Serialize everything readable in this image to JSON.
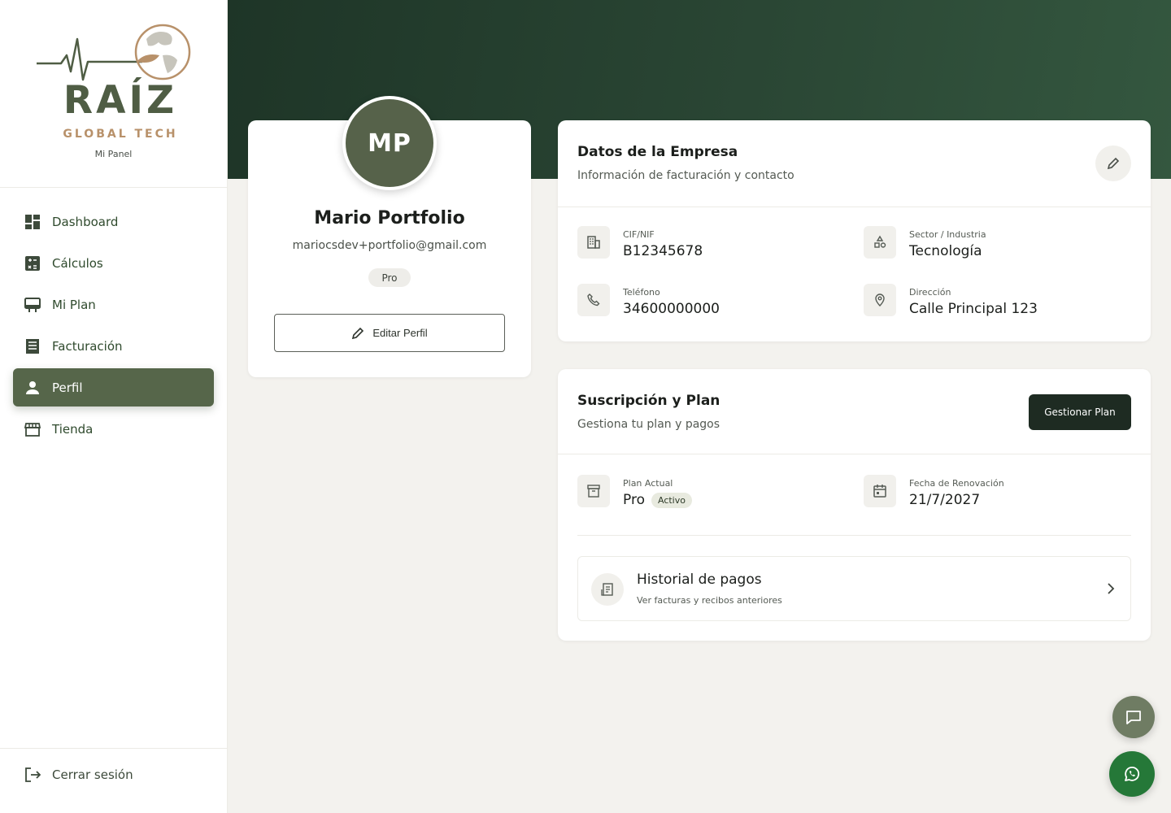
{
  "brand": {
    "name": "RAÍZ",
    "tagline": "GLOBAL TECH",
    "panel": "Mi Panel"
  },
  "sidebar": {
    "items": [
      {
        "label": "Dashboard",
        "icon": "dashboard-icon"
      },
      {
        "label": "Cálculos",
        "icon": "calculator-icon"
      },
      {
        "label": "Mi Plan",
        "icon": "plan-icon"
      },
      {
        "label": "Facturación",
        "icon": "billing-icon"
      },
      {
        "label": "Perfil",
        "icon": "person-icon",
        "active": true
      },
      {
        "label": "Tienda",
        "icon": "store-icon"
      }
    ],
    "logout": "Cerrar sesión"
  },
  "profile": {
    "initials": "MP",
    "name": "Mario Portfolio",
    "email": "mariocsdev+portfolio@gmail.com",
    "badge": "Pro",
    "edit_label": "Editar Perfil"
  },
  "company": {
    "title": "Datos de la Empresa",
    "subtitle": "Información de facturación y contacto",
    "fields": {
      "cif": {
        "label": "CIF/NIF",
        "value": "B12345678"
      },
      "sector": {
        "label": "Sector / Industria",
        "value": "Tecnología"
      },
      "phone": {
        "label": "Teléfono",
        "value": "34600000000"
      },
      "address": {
        "label": "Dirección",
        "value": "Calle Principal 123"
      }
    }
  },
  "subscription": {
    "title": "Suscripción y Plan",
    "subtitle": "Gestiona tu plan y pagos",
    "manage_label": "Gestionar Plan",
    "plan": {
      "label": "Plan Actual",
      "value": "Pro",
      "status": "Activo"
    },
    "renewal": {
      "label": "Fecha de Renovación",
      "value": "21/7/2027"
    },
    "history": {
      "title": "Historial de pagos",
      "subtitle": "Ver facturas y recibos anteriores"
    }
  },
  "colors": {
    "primary": "#56664a",
    "header_band": "#2a4634",
    "dark_button": "#1e2b22",
    "whatsapp": "#257838",
    "brand_gold": "#b8916a"
  }
}
